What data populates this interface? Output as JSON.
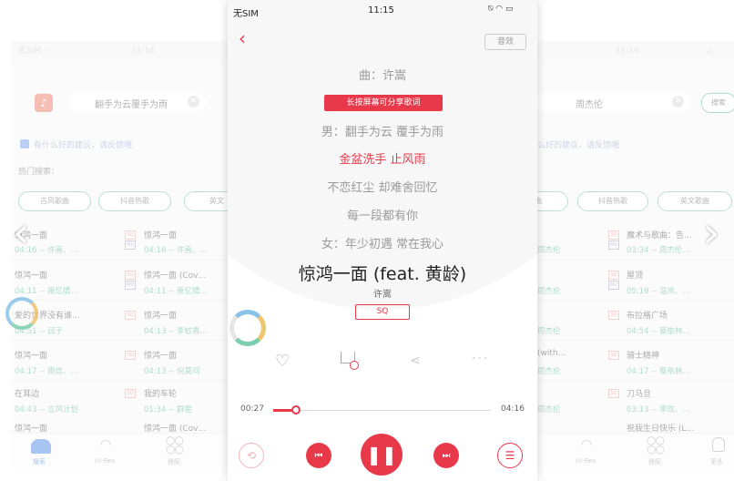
{
  "left_screen": {
    "status": {
      "carrier": "无SIM ···",
      "time": "11:14"
    },
    "search_query": "翻手为云覆手为雨",
    "feedback": "有什么好的建议，请反馈哦",
    "hot_label": "热门搜索：",
    "pills": [
      "古风歌曲",
      "抖音热歌",
      "英文"
    ],
    "songs": [
      {
        "title": "惊鸿一面",
        "meta": "04:16 -- 许嵩、…",
        "tag": "SQ"
      },
      {
        "title": "惊鸿一面",
        "meta": "04:16 -- 许嵩、…",
        "tag": "SQ"
      },
      {
        "title": "惊鸿一面",
        "meta": "04:11 -- 萧忆情…",
        "tag": "SQ"
      },
      {
        "title": "惊鸿一面 (Cov…",
        "meta": "04:11 -- 萧忆情…",
        "tag": "SQ"
      },
      {
        "title": "爱的世界没有谁…",
        "meta": "04:51 -- 润子",
        "tag": "SQ"
      },
      {
        "title": "惊鸿一面",
        "meta": "04:13 -- 李蚊香…",
        "tag": "SQ"
      },
      {
        "title": "惊鸿一面",
        "meta": "04:17 -- 南信、…",
        "tag": "HQ"
      },
      {
        "title": "惊鸿一面",
        "meta": "04:13 -- 倪莫问",
        "tag": "SQ"
      },
      {
        "title": "在耳边",
        "meta": "04:43 -- 立风计划",
        "tag": "SQ"
      },
      {
        "title": "我的车轮",
        "meta": "01:34 -- 群星",
        "tag": "SQ"
      },
      {
        "title": "惊鸿一面",
        "meta": "",
        "tag": ""
      },
      {
        "title": "惊鸿一面 (Cov…",
        "meta": "",
        "tag": ""
      }
    ],
    "tabs": [
      {
        "label": "搜索",
        "icon": "home-icon"
      },
      {
        "label": "Hi-Res",
        "icon": "wifi-icon"
      },
      {
        "label": "搭配",
        "icon": "grid-icon"
      }
    ]
  },
  "right_screen": {
    "status": {
      "time": "11:16"
    },
    "search_query": "周杰伦",
    "search_button": "搜索",
    "feedback": "么好的建议，请反馈哦",
    "pills": [
      "歌曲",
      "抖音热歌",
      "英文歌曲"
    ],
    "songs": [
      {
        "title": "",
        "meta": "周杰伦"
      },
      {
        "title": "魔术与歌曲：告…",
        "meta": "03:34 -- 周杰伦…",
        "tag": "SQ"
      },
      {
        "title": "",
        "meta": "周杰伦"
      },
      {
        "title": "屋顶",
        "meta": "05:19 -- 温岚、…",
        "tag": "SQ"
      },
      {
        "title": "",
        "meta": "周杰伦"
      },
      {
        "title": "布拉格广场",
        "meta": "04:54 -- 蔡依林…",
        "tag": "SQ"
      },
      {
        "title": "(with…",
        "meta": "周杰伦"
      },
      {
        "title": "骑士精神",
        "meta": "04:17 -- 蔡依林…",
        "tag": "SQ"
      },
      {
        "title": "",
        "meta": "周杰伦"
      },
      {
        "title": "刀马旦",
        "meta": "03:13 -- 李玟、…",
        "tag": "SQ"
      },
      {
        "title": "",
        "meta": ""
      },
      {
        "title": "祝我生日快乐 (L…",
        "meta": ""
      }
    ],
    "tabs": [
      {
        "label": "Hi-Res",
        "icon": "wifi-icon"
      },
      {
        "label": "搭配",
        "icon": "grid-icon"
      },
      {
        "label": "更多",
        "icon": "person-icon"
      }
    ]
  },
  "player": {
    "status": {
      "carrier": "无SIM",
      "time": "11:15"
    },
    "sound_effect_button": "音效",
    "composer": "曲：许嵩",
    "share_hint": "长按屏幕可分享歌词",
    "lyrics": [
      {
        "text": "男：翻手为云 覆手为雨",
        "active": false
      },
      {
        "text": "金盆洗手 止风雨",
        "active": true
      },
      {
        "text": "不恋红尘 却难舍回忆",
        "active": false
      },
      {
        "text": "每一段都有你",
        "active": false
      },
      {
        "text": "女：年少初遇 常在我心",
        "active": false
      }
    ],
    "song_title": "惊鸿一面 (feat. 黄龄)",
    "artist": "许嵩",
    "quality": "SQ",
    "elapsed": "00:27",
    "duration": "04:16",
    "progress": 0.105,
    "accent": "#e8394b"
  }
}
